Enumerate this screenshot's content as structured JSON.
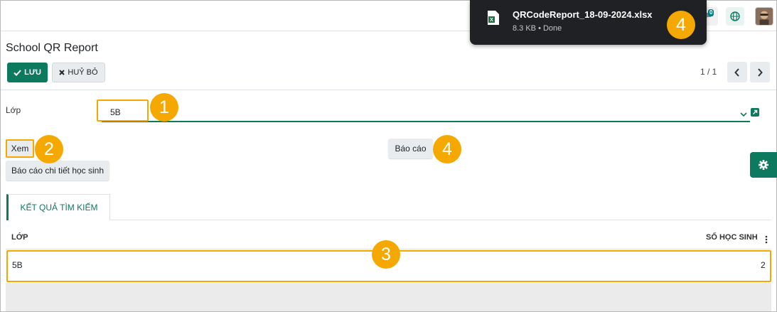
{
  "topbar": {
    "chat_badge": "0"
  },
  "download": {
    "file_name": "QRCodeReport_18-09-2024.xlsx",
    "meta": "8.3 KB • Done"
  },
  "control_panel": {
    "title": "School QR Report",
    "save_label": "LƯU",
    "discard_label": "HUỶ BỎ",
    "pager": "1 / 1"
  },
  "form": {
    "class_label": "Lớp",
    "class_value": "5B",
    "view_button": "Xem",
    "report_button": "Báo cáo",
    "detail_button": "Báo cáo chi tiết học sinh"
  },
  "tabs": [
    {
      "label": "KẾT QUẢ TÌM KIẾM",
      "active": true
    }
  ],
  "table": {
    "headers": [
      "LỚP",
      "SỐ HỌC SINH"
    ],
    "rows": [
      [
        "5B",
        "2"
      ]
    ]
  },
  "markers": [
    "1",
    "2",
    "3",
    "4",
    "4"
  ],
  "colors": {
    "accent": "#0d7a5f",
    "marker": "#f5a800",
    "popup_bg": "#202124"
  }
}
